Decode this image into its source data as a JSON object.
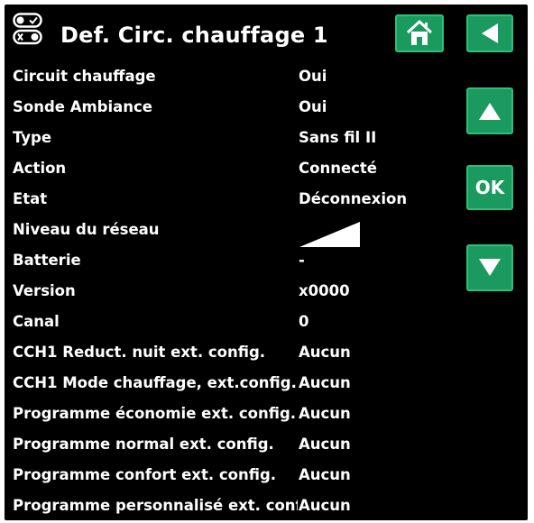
{
  "header": {
    "title": "Def. Circ. chauffage 1",
    "icon": "heating-circuit-toggle-icon"
  },
  "buttons": {
    "home": "home-icon",
    "back": "back-arrow-icon",
    "up": "up-arrow-icon",
    "ok": "OK",
    "down": "down-arrow-icon"
  },
  "rows": [
    {
      "label": "Circuit chauffage",
      "value": "Oui"
    },
    {
      "label": "Sonde Ambiance",
      "value": "Oui"
    },
    {
      "label": "Type",
      "value": "Sans fil II"
    },
    {
      "label": "Action",
      "value": "Connecté"
    },
    {
      "label": "Etat",
      "value": "Déconnexion"
    },
    {
      "label": "Niveau du réseau",
      "value": ""
    },
    {
      "label": "Batterie",
      "value": "-"
    },
    {
      "label": "Version",
      "value": "x0000"
    },
    {
      "label": "Canal",
      "value": "0"
    },
    {
      "label": "CCH1 Reduct. nuit ext. config.",
      "value": "Aucun"
    },
    {
      "label": "CCH1 Mode chauffage, ext.config.",
      "value": "Aucun"
    },
    {
      "label": "Programme économie ext. config.",
      "value": "Aucun"
    },
    {
      "label": "Programme normal ext. config.",
      "value": "Aucun"
    },
    {
      "label": "Programme confort ext. config.",
      "value": "Aucun"
    },
    {
      "label": "Programme personnalisé ext. config.",
      "value": "Aucun"
    }
  ],
  "signal_level": 1.0,
  "colors": {
    "background": "#000000",
    "text": "#ffffff",
    "button_fill": "#1a9a5e",
    "button_border": "#2cc07a"
  }
}
